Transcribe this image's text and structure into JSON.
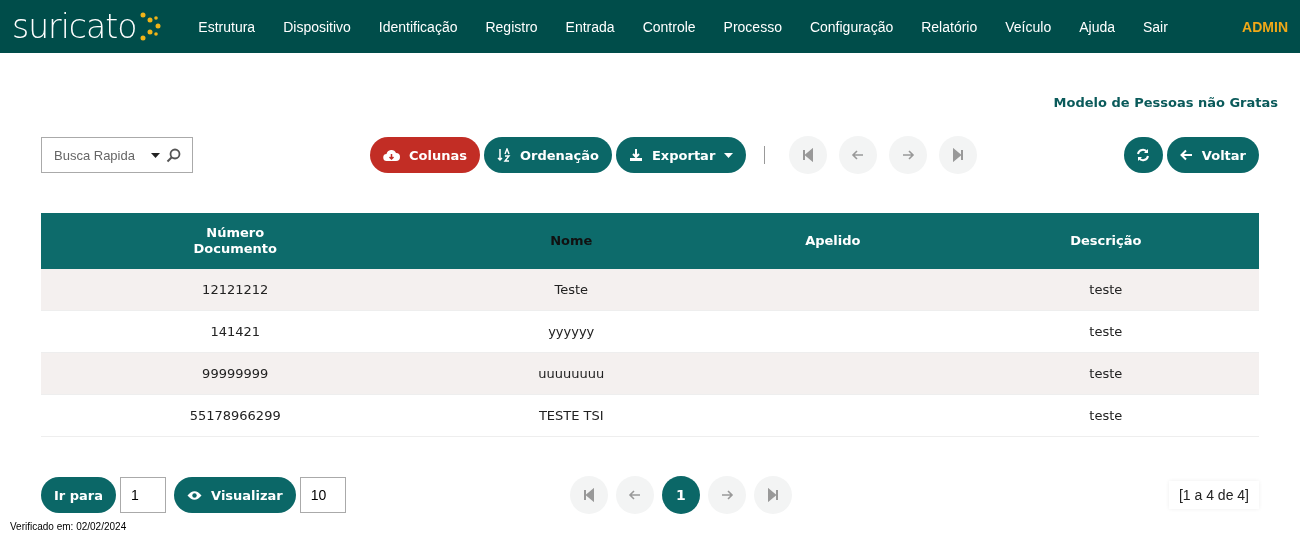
{
  "header": {
    "logo": "suricato",
    "menu": [
      "Estrutura",
      "Dispositivo",
      "Identificação",
      "Registro",
      "Entrada",
      "Controle",
      "Processo",
      "Configuração",
      "Relatório",
      "Veículo",
      "Ajuda",
      "Sair"
    ],
    "user": "ADMIN"
  },
  "page_title": "Modelo de Pessoas não Gratas",
  "toolbar": {
    "search": {
      "placeholder": "Busca Rapida"
    },
    "buttons": [
      {
        "label": "Colunas",
        "kind": "danger",
        "dropdown": false
      },
      {
        "label": "Ordenação",
        "kind": "primary",
        "dropdown": false
      },
      {
        "label": "Exportar",
        "kind": "primary",
        "dropdown": true
      }
    ],
    "nav_disabled": true,
    "voltar": "Voltar"
  },
  "table": {
    "columns": [
      {
        "label": "Número\nDocumento",
        "sorted": false
      },
      {
        "label": "Nome",
        "sorted": true
      },
      {
        "label": "Apelido",
        "sorted": false
      },
      {
        "label": "Descrição",
        "sorted": false
      }
    ],
    "rows": [
      [
        "12121212",
        "Teste",
        "",
        "teste"
      ],
      [
        "141421",
        "yyyyyy",
        "",
        "teste"
      ],
      [
        "99999999",
        "uuuuuuuu",
        "",
        "teste"
      ],
      [
        "55178966299",
        "TESTE TSI",
        "",
        "teste"
      ]
    ]
  },
  "footer": {
    "goto_label": "Ir para",
    "goto_value": "1",
    "view_label": "Visualizar",
    "view_value": "10",
    "pages": [
      {
        "label": "1",
        "selected": true
      }
    ],
    "range": "[1 a 4 de 4]",
    "verified": "Verificado em: 02/02/2024"
  }
}
